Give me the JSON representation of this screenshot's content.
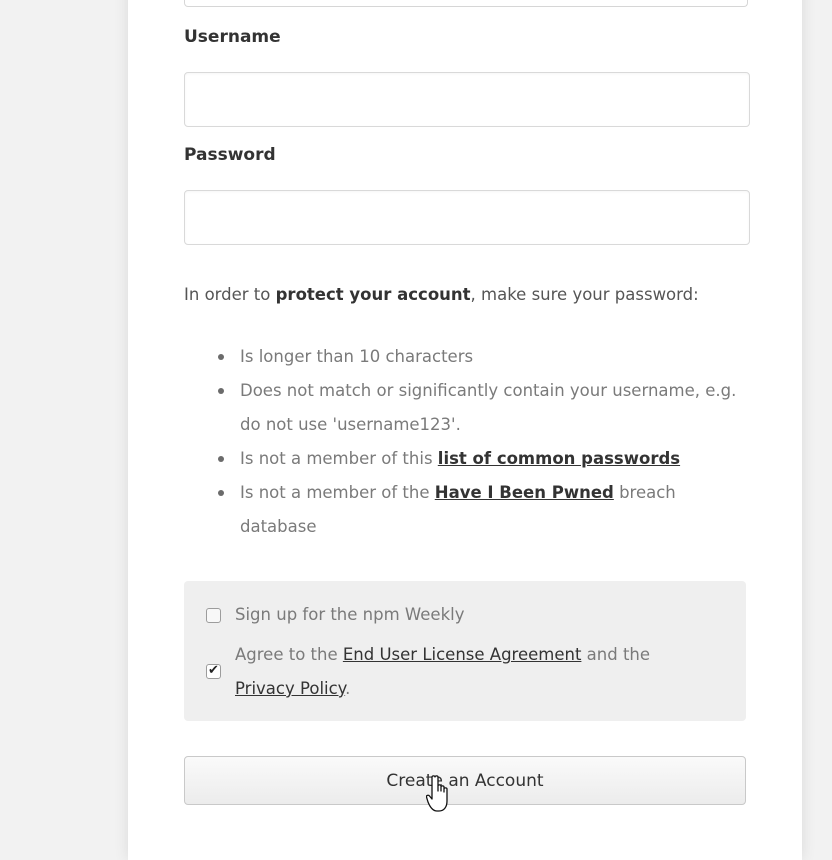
{
  "form": {
    "username": {
      "label": "Username",
      "value": "",
      "placeholder": ""
    },
    "password": {
      "label": "Password",
      "value": "",
      "placeholder": ""
    },
    "intro": {
      "before": "In order to ",
      "strong": "protect your account",
      "after": ", make sure your password:"
    },
    "rules": [
      {
        "text": "Is longer than 10 characters"
      },
      {
        "text": "Does not match or significantly contain your username, e.g. do not use 'username123'."
      },
      {
        "before": "Is not a member of this ",
        "link": "list of common passwords",
        "after": ""
      },
      {
        "before": "Is not a member of the ",
        "link": "Have I Been Pwned",
        "after": " breach database"
      }
    ],
    "preferences": {
      "newsletter": {
        "label": "Sign up for the npm Weekly",
        "checked": false
      },
      "agreement": {
        "before": "Agree to the ",
        "eula_link": "End User License Agreement",
        "middle": " and the",
        "privacy_link": "Privacy Policy",
        "after": ".",
        "checked": true
      }
    },
    "submit_label": "Create an Account"
  },
  "icons": {
    "checkmark": "checkmark-icon",
    "cursor": "hand-pointer-cursor-icon"
  },
  "colors": {
    "background": "#f2f2f2",
    "card": "#ffffff",
    "text": "#333333",
    "muted_text": "#7a7a7a",
    "panel": "#efefef"
  }
}
